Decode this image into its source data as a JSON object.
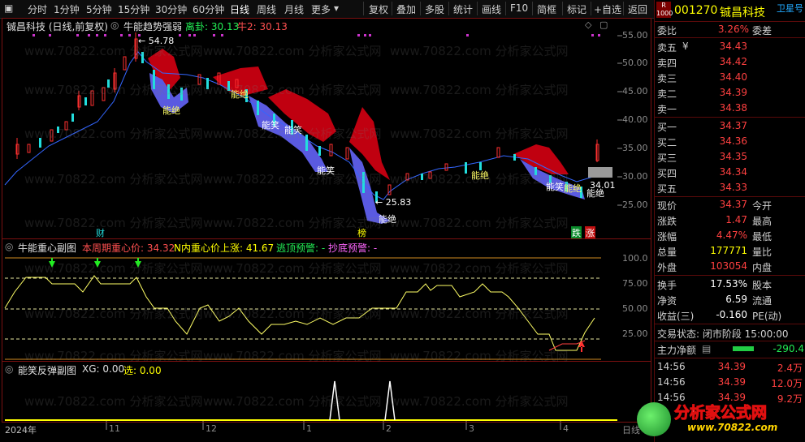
{
  "toolbar": {
    "left_items": [
      "分时",
      "1分钟",
      "5分钟",
      "15分钟",
      "30分钟",
      "60分钟",
      "日线",
      "周线",
      "月线",
      "更多"
    ],
    "active": "日线",
    "right_items": [
      "复权",
      "叠加",
      "多股",
      "统计",
      "画线",
      "F10",
      "简框",
      "标记",
      "+自选",
      "返回"
    ]
  },
  "main_pane": {
    "title": "铖昌科技 (日线,前复权)",
    "indicator_name": "牛能趋势强弱",
    "indicator_value1_label": "离卦: 30.13",
    "indicator_value2_label": "牛2: 30.13",
    "price_axis": [
      "55.00",
      "50.00",
      "45.00",
      "40.00",
      "35.00",
      "30.00",
      "25.00"
    ],
    "high_label": "54.78",
    "low_label": "25.83",
    "current_tag": "34.01",
    "labels": [
      "能笑",
      "能笑",
      "能笑",
      "能笑",
      "能笑",
      "能绝",
      "能绝",
      "能绝",
      "能笑",
      "能绝",
      "能笑",
      "能绝",
      "能绝"
    ],
    "bottom_badges": {
      "cai": "财",
      "bang": "榜",
      "die": "跌",
      "zhang": "涨"
    }
  },
  "sub_pane1": {
    "title": "牛能重心副图",
    "field1": "本周期重心价: 34.32",
    "field2": "N内重心价上涨: 41.67",
    "field3": "逃顶预警: -",
    "field4": "抄底预警: -",
    "axis": [
      "100.0",
      "75.00",
      "50.00",
      "25.00"
    ]
  },
  "sub_pane2": {
    "title": "能笑反弹副图",
    "field1": "XG: 0.00",
    "field2": "选: 0.00"
  },
  "time_axis": [
    "2024年",
    "11",
    "12",
    "1",
    "2",
    "3",
    "4",
    "日线"
  ],
  "quote": {
    "code": "001270",
    "name": "铖昌科技",
    "satellite": "卫星号",
    "wei_bi_label": "委比",
    "wei_bi": "3.26%",
    "wei_cha_label": "委差",
    "sells": [
      {
        "label": "卖五",
        "price": "34.43"
      },
      {
        "label": "卖四",
        "price": "34.42"
      },
      {
        "label": "卖三",
        "price": "34.40"
      },
      {
        "label": "卖二",
        "price": "34.39"
      },
      {
        "label": "卖一",
        "price": "34.38"
      }
    ],
    "buys": [
      {
        "label": "买一",
        "price": "34.37"
      },
      {
        "label": "买二",
        "price": "34.36"
      },
      {
        "label": "买三",
        "price": "34.35"
      },
      {
        "label": "买四",
        "price": "34.34"
      },
      {
        "label": "买五",
        "price": "34.33"
      }
    ],
    "stats": [
      {
        "label": "现价",
        "value": "34.37",
        "ext": "今开"
      },
      {
        "label": "涨跌",
        "value": "1.47",
        "ext": "最高"
      },
      {
        "label": "涨幅",
        "value": "4.47%",
        "ext": "最低"
      },
      {
        "label": "总量",
        "value": "177771",
        "ext": "量比"
      },
      {
        "label": "外盘",
        "value": "103054",
        "ext": "内盘"
      }
    ],
    "finance": [
      {
        "label": "换手",
        "value": "17.53%",
        "ext": "股本"
      },
      {
        "label": "净资",
        "value": "6.59",
        "ext": "流通"
      },
      {
        "label": "收益(三)",
        "value": "-0.160",
        "ext": "PE(动)"
      }
    ],
    "trade_status": "交易状态: 闭市阶段 15:00:00",
    "main_flow_label": "主力净额",
    "main_flow_value": "-290.4",
    "ticks": [
      {
        "time": "14:56",
        "price": "34.39",
        "vol": "2.4万"
      },
      {
        "time": "14:56",
        "price": "34.39",
        "vol": "12.0万"
      },
      {
        "time": "14:56",
        "price": "34.39",
        "vol": "9.2万"
      }
    ]
  },
  "watermark": "www.70822.com 分析家公式网",
  "logo": {
    "cn": "分析家公式网",
    "url": "www.70822.com"
  },
  "colors": {
    "up": "#ff3030",
    "down": "#22dddd",
    "cloud_red": "#c00010",
    "cloud_blue": "#5a5ae0",
    "axis": "#8a8a8a",
    "border": "#7a1010"
  }
}
